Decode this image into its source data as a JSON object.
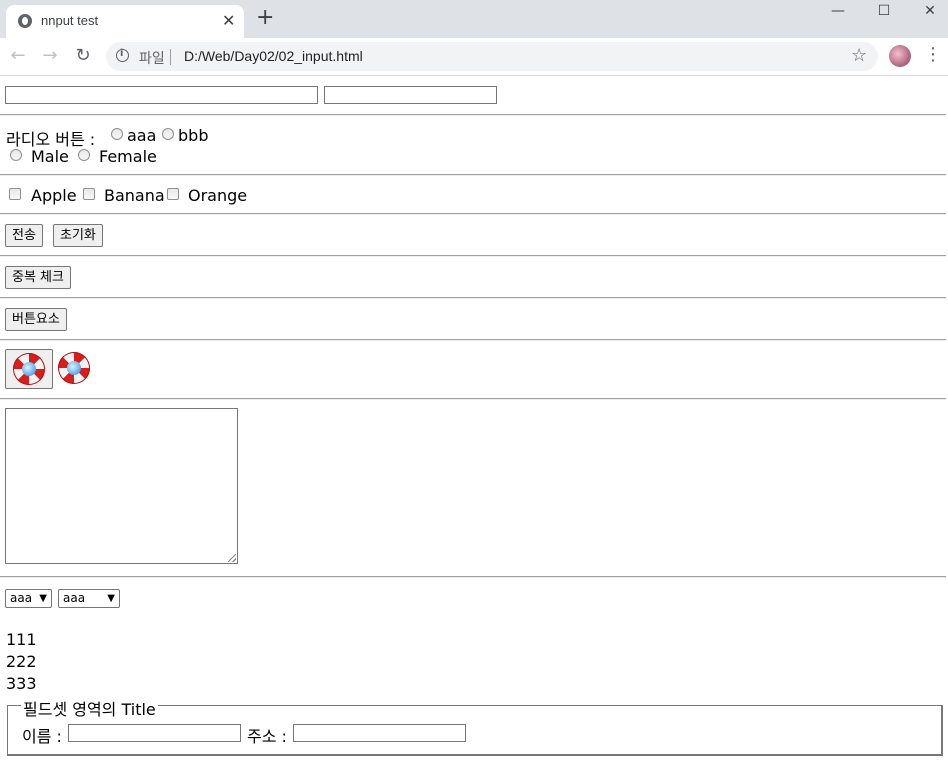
{
  "browser": {
    "tab_title": "nnput test",
    "tab_close": "✕",
    "new_tab": "+",
    "scheme_label": "파일",
    "url": "D:/Web/Day02/02_input.html",
    "window_controls": {
      "minimize": "—",
      "maximize": "☐",
      "close": "✕"
    },
    "nav": {
      "back": "←",
      "forward": "→",
      "reload": "↻"
    },
    "star": "☆",
    "menu": "⋮"
  },
  "form": {
    "radio_label": "라디오 버튼 :",
    "radio_options_1": [
      "aaa",
      "bbb"
    ],
    "radio_options_2": [
      "Male",
      "Female"
    ],
    "checkboxes": [
      "Apple",
      "Banana",
      "Orange"
    ],
    "buttons": {
      "submit": "전송",
      "reset": "초기화",
      "dup_check": "중복 체크",
      "button_element": "버튼요소"
    },
    "select1": {
      "selected": "aaa"
    },
    "select2": {
      "selected": "aaa"
    },
    "list_values": [
      "111",
      "222",
      "333"
    ],
    "fieldset": {
      "legend": "필드셋 영역의 Title",
      "name_label": "이름 :",
      "address_label": "주소 :"
    }
  },
  "colors": {
    "tabstrip": "#dee1e6",
    "accent_red": "#d91c1c"
  }
}
